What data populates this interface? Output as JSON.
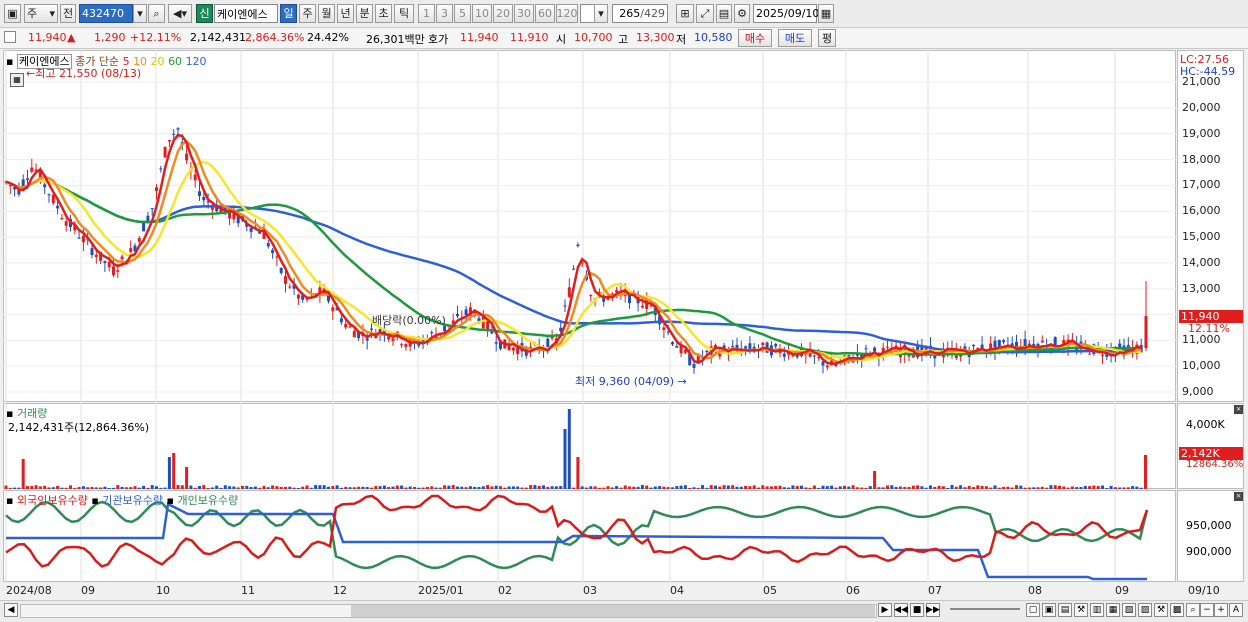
{
  "toolbar": {
    "market": "주",
    "period_type": "전",
    "code": "432470",
    "badge": "신",
    "stock_name": "케이엔에스",
    "periods": [
      "일",
      "주",
      "월",
      "년",
      "분",
      "초",
      "틱"
    ],
    "numbers": [
      "1",
      "3",
      "5",
      "10",
      "20",
      "30",
      "60",
      "120"
    ],
    "count": "265",
    "count_total": "/429",
    "date": "2025/09/10"
  },
  "info": {
    "price": "11,940",
    "change": "1,290",
    "change_pct": "+12.11%",
    "volume": "2,142,431",
    "volume_ratio": "2,864.36%",
    "turnover": "24.42%",
    "amount": "26,301백만",
    "bid_label": "호가",
    "ask": "11,940",
    "bid": "11,910",
    "open_label": "시",
    "open": "10,700",
    "high_label": "고",
    "high": "13,300",
    "low_label": "저",
    "low": "10,580",
    "sell_btn": "매수",
    "buy_btn": "매도",
    "eval_btn": "평"
  },
  "price_panel": {
    "name": "케이엔에스",
    "ma_label": "종가 단순",
    "ma_periods": [
      "5",
      "10",
      "20",
      "60",
      "120"
    ],
    "ma_colors": [
      "#e01e1e",
      "#f08a1e",
      "#f5e62a",
      "#1e9a3c",
      "#2f5fd8"
    ],
    "high_note": "최고 21,550 (08/13)",
    "low_note": "최저 9,360 (04/09)",
    "dividend_note": "배당락(0.00%)",
    "lc": "LC:27.56",
    "hc": "HC:-44.59",
    "y_ticks": [
      "21,000",
      "20,000",
      "19,000",
      "18,000",
      "17,000",
      "16,000",
      "15,000",
      "14,000",
      "13,000",
      "12,000",
      "11,000",
      "10,000",
      "9,000"
    ],
    "last_price_tag": "11,940",
    "last_pct_tag": "12.11%"
  },
  "volume_panel": {
    "title": "거래량",
    "value": "2,142,431주(12,864.36%)",
    "y_tick": "4,000K",
    "last_tag": "2,142K",
    "last_pct": "12864.36%"
  },
  "holding_panel": {
    "legend": [
      "외국인보유수량",
      "기관보유수량",
      "개인보유수량"
    ],
    "legend_colors": [
      "#d81c1c",
      "#2f5fd8",
      "#2e8b57"
    ],
    "y_ticks": [
      "950,000",
      "900,000"
    ]
  },
  "x_ticks": [
    "2024/08",
    "09",
    "10",
    "11",
    "12",
    "2025/01",
    "02",
    "03",
    "04",
    "05",
    "06",
    "07",
    "08",
    "09"
  ],
  "x_end": "09/10",
  "chart_data": {
    "type": "line",
    "title": "케이엔에스",
    "x": [
      "2024/08",
      "09",
      "10",
      "11",
      "12",
      "2025/01",
      "02",
      "03",
      "04",
      "05",
      "06",
      "07",
      "08",
      "09"
    ],
    "series": [
      {
        "name": "5",
        "values": [
          17200,
          14500,
          18500,
          16000,
          12000,
          11200,
          10800,
          14000,
          10500,
          10600,
          10700,
          10800,
          10900,
          11940
        ]
      },
      {
        "name": "120",
        "values": [
          17300,
          17000,
          16800,
          16600,
          16000,
          15000,
          14000,
          13000,
          12000,
          11300,
          11100,
          11000,
          10900,
          10800
        ]
      }
    ],
    "ylim": [
      9000,
      21550
    ]
  }
}
